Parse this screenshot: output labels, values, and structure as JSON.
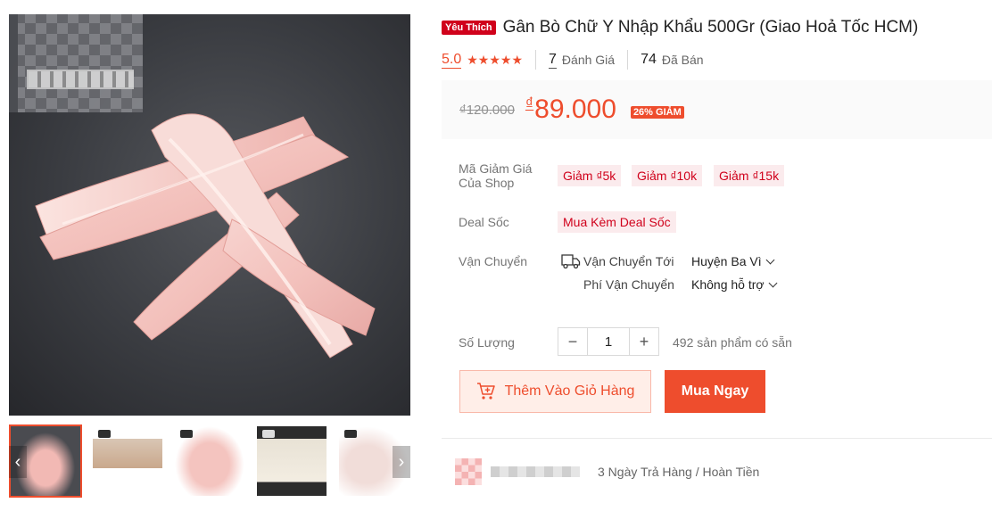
{
  "product": {
    "badge": "Yêu Thích",
    "title": "Gân Bò Chữ Y Nhập Khẩu 500Gr (Giao Hoả Tốc HCM)",
    "rating": "5.0",
    "stars": "★★★★★",
    "review_count": "7",
    "review_label": "Đánh Giá",
    "sold_count": "74",
    "sold_label": "Đã Bán"
  },
  "price": {
    "original": "₫120.000",
    "currency": "₫",
    "current": "89.000",
    "discount": "26% GIẢM"
  },
  "vouchers": {
    "label": "Mã Giảm Giá Của Shop",
    "items": [
      "Giảm ₫5k",
      "Giảm ₫10k",
      "Giảm ₫15k"
    ]
  },
  "deal": {
    "label": "Deal Sốc",
    "chip": "Mua Kèm Deal Sốc"
  },
  "shipping": {
    "label": "Vận Chuyển",
    "to_label": "Vận Chuyển Tới",
    "to_value": "Huyện Ba Vì",
    "fee_label": "Phí Vận Chuyển",
    "fee_value": "Không hỗ trợ"
  },
  "quantity": {
    "label": "Số Lượng",
    "minus": "−",
    "value": "1",
    "plus": "+",
    "stock": "492 sản phẩm có sẵn"
  },
  "actions": {
    "add_to_cart": "Thêm Vào Giỏ Hàng",
    "buy_now": "Mua Ngay"
  },
  "guarantee": {
    "text": "3 Ngày Trả Hàng / Hoàn Tiền"
  },
  "gallery": {
    "prev": "‹",
    "next": "›"
  },
  "colors": {
    "accent": "#ee4d2d",
    "favorite_badge": "#d0011b"
  }
}
